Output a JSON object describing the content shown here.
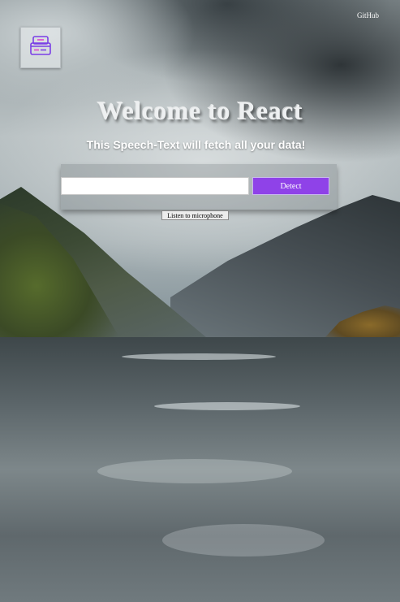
{
  "header": {
    "github_link": "GitHub"
  },
  "hero": {
    "title": "Welcome to React",
    "subtitle": "This Speech-Text will fetch all your data!"
  },
  "form": {
    "input_value": "",
    "detect_label": "Detect",
    "mic_label": "Listen to microphone"
  },
  "icons": {
    "logo": "inbox-tray-icon"
  },
  "colors": {
    "accent": "#8f42e8",
    "logo_stroke": "#7a3ee6",
    "logo_fill": "#e13fd0"
  }
}
